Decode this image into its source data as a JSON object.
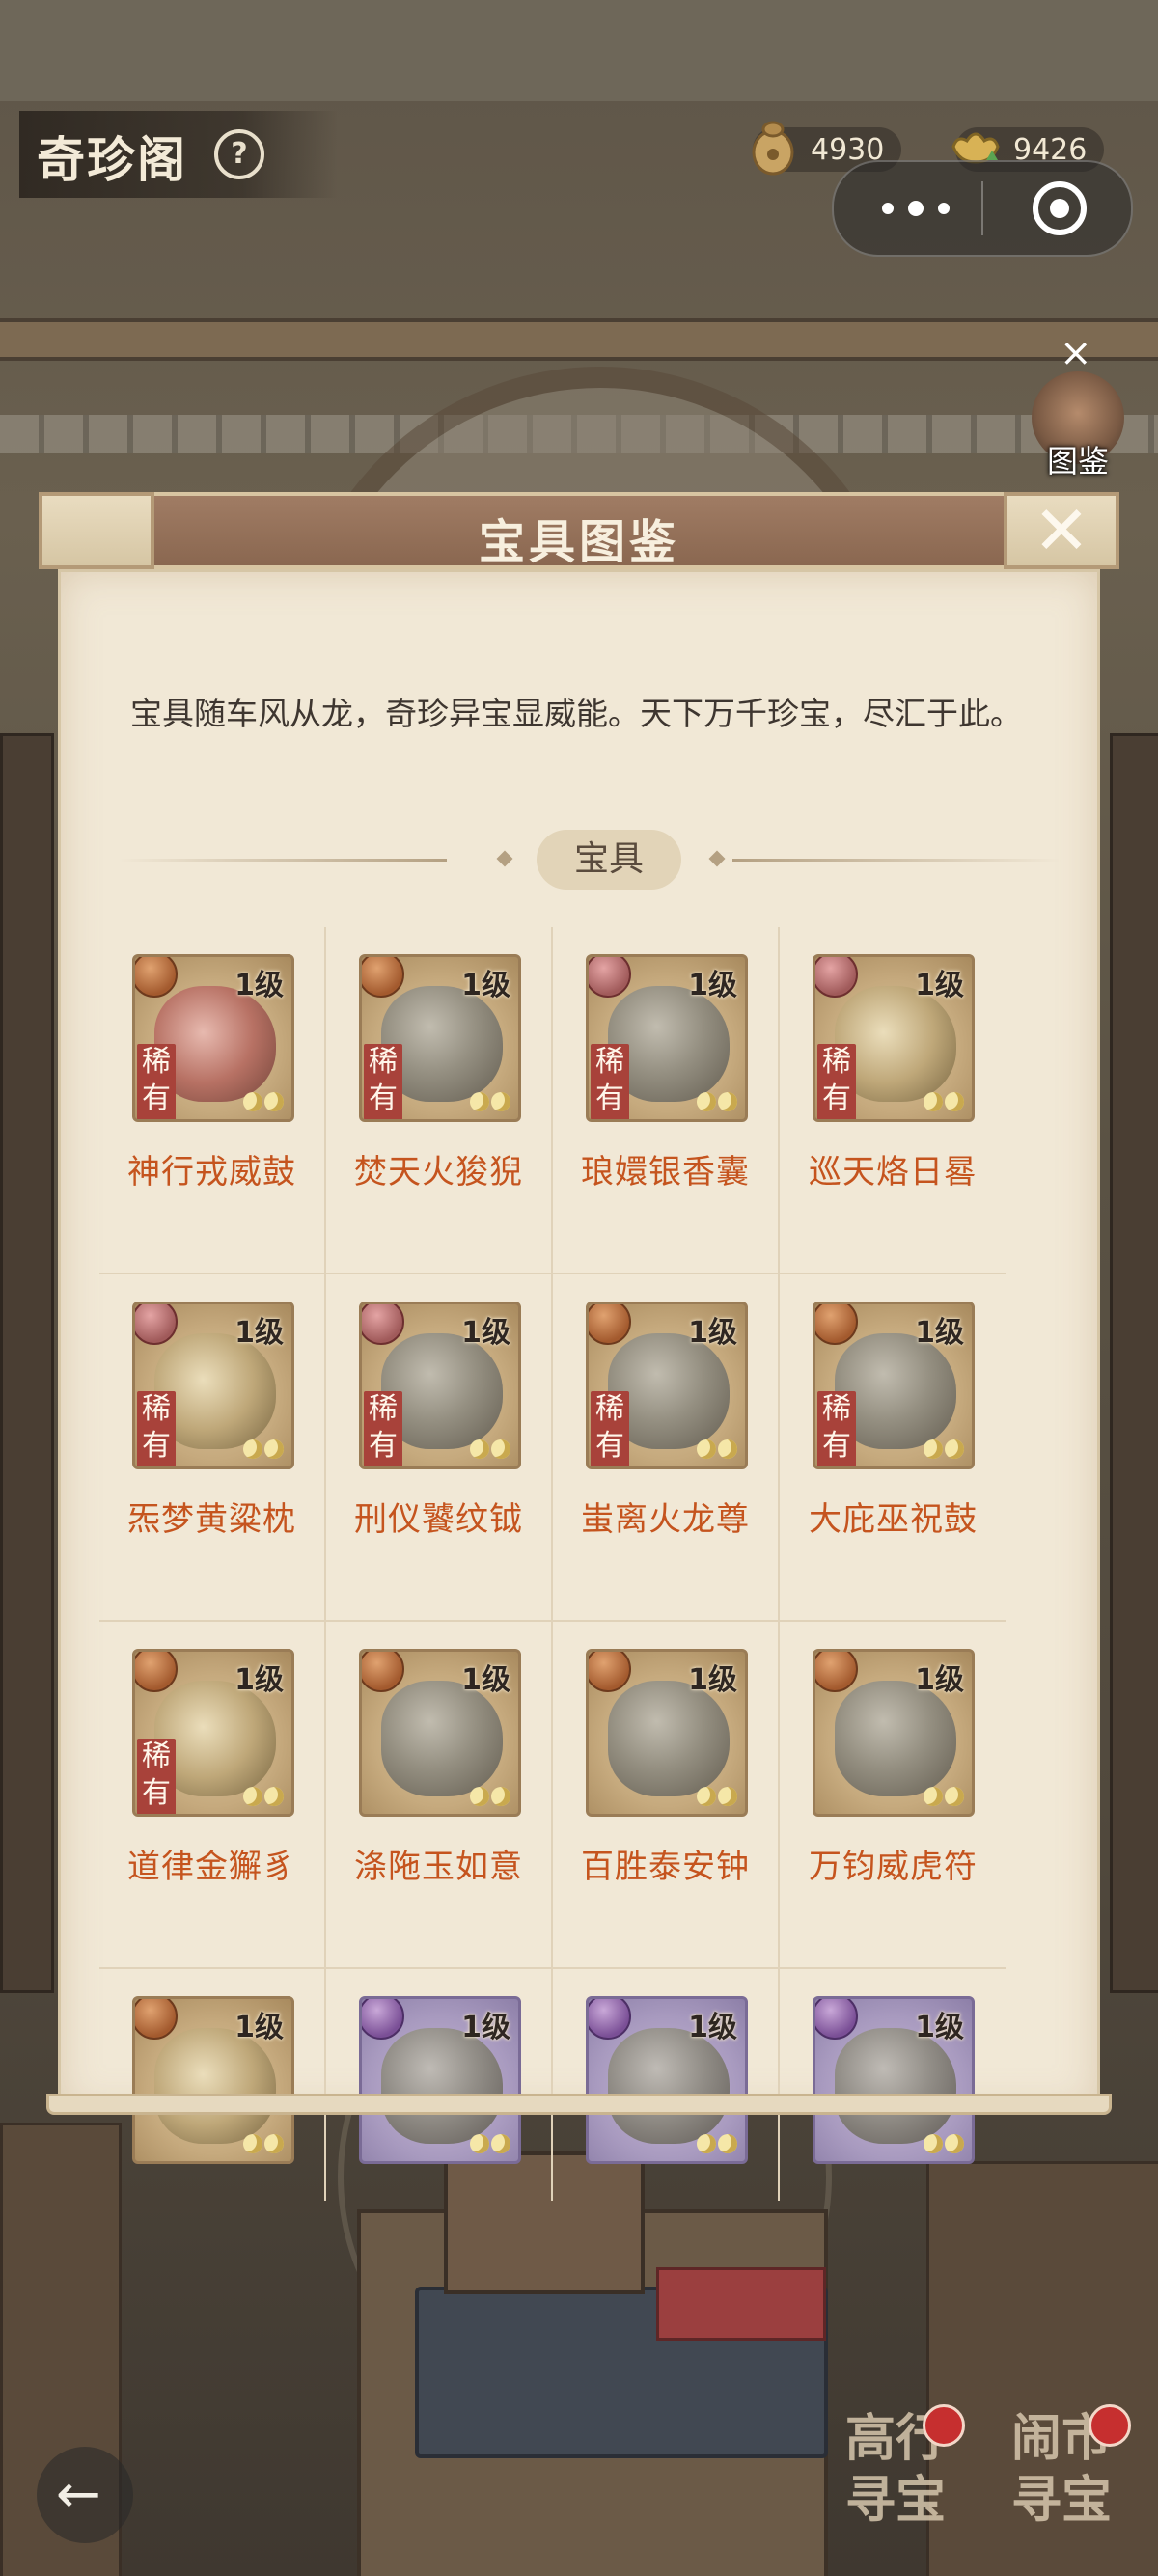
{
  "header": {
    "page_title": "奇珍阁",
    "help_symbol": "?",
    "currency_a": {
      "icon": "coin-pouch-icon",
      "amount": "4930"
    },
    "currency_b": {
      "icon": "gold-ingot-icon",
      "amount": "9426"
    },
    "side_close_symbol": "×",
    "side_shortcut_label": "图鉴"
  },
  "dialog": {
    "title": "宝具图鉴",
    "close_symbol": "✕",
    "intro": "宝具随车风从龙，奇珍异宝显威能。天下万千珍宝，尽汇于此。",
    "section_label": "宝具",
    "items": [
      {
        "name": "神行戎威鼓",
        "level": "1级",
        "rare": "稀有",
        "frame": "tan",
        "emblem": "bronze",
        "art": "red"
      },
      {
        "name": "焚天火狻猊",
        "level": "1级",
        "rare": "稀有",
        "frame": "tan",
        "emblem": "bronze",
        "art": "gray"
      },
      {
        "name": "琅嬛银香囊",
        "level": "1级",
        "rare": "稀有",
        "frame": "tan",
        "emblem": "pink",
        "art": "gray"
      },
      {
        "name": "巡天烙日晷",
        "level": "1级",
        "rare": "稀有",
        "frame": "tan",
        "emblem": "pink",
        "art": "gold"
      },
      {
        "name": "炁梦黄粱枕",
        "level": "1级",
        "rare": "稀有",
        "frame": "tan",
        "emblem": "pink",
        "art": "gold"
      },
      {
        "name": "刑仪饕纹钺",
        "level": "1级",
        "rare": "稀有",
        "frame": "tan",
        "emblem": "pink",
        "art": "gray"
      },
      {
        "name": "蚩离火龙尊",
        "level": "1级",
        "rare": "稀有",
        "frame": "tan",
        "emblem": "bronze",
        "art": "gray"
      },
      {
        "name": "大庇巫祝鼓",
        "level": "1级",
        "rare": "稀有",
        "frame": "tan",
        "emblem": "bronze",
        "art": "gray"
      },
      {
        "name": "道律金獬豸",
        "level": "1级",
        "rare": "稀有",
        "frame": "tan",
        "emblem": "bronze",
        "art": "gold"
      },
      {
        "name": "涤陁玉如意",
        "level": "1级",
        "rare": "",
        "frame": "tan",
        "emblem": "bronze",
        "art": "gray"
      },
      {
        "name": "百胜泰安钟",
        "level": "1级",
        "rare": "",
        "frame": "tan",
        "emblem": "bronze",
        "art": "gray"
      },
      {
        "name": "万钧威虎符",
        "level": "1级",
        "rare": "",
        "frame": "tan",
        "emblem": "bronze",
        "art": "gray"
      },
      {
        "name": "",
        "level": "1级",
        "rare": "",
        "frame": "tan",
        "emblem": "bronze",
        "art": "gold"
      },
      {
        "name": "",
        "level": "1级",
        "rare": "",
        "frame": "purple",
        "emblem": "violet",
        "art": "gray"
      },
      {
        "name": "",
        "level": "1级",
        "rare": "",
        "frame": "purple",
        "emblem": "violet",
        "art": "gray"
      },
      {
        "name": "",
        "level": "1级",
        "rare": "",
        "frame": "purple",
        "emblem": "violet",
        "art": "gray"
      }
    ]
  },
  "bottom": {
    "back_symbol": "←",
    "shortcut_a": "高行寻宝",
    "shortcut_b": "闹市寻宝"
  }
}
